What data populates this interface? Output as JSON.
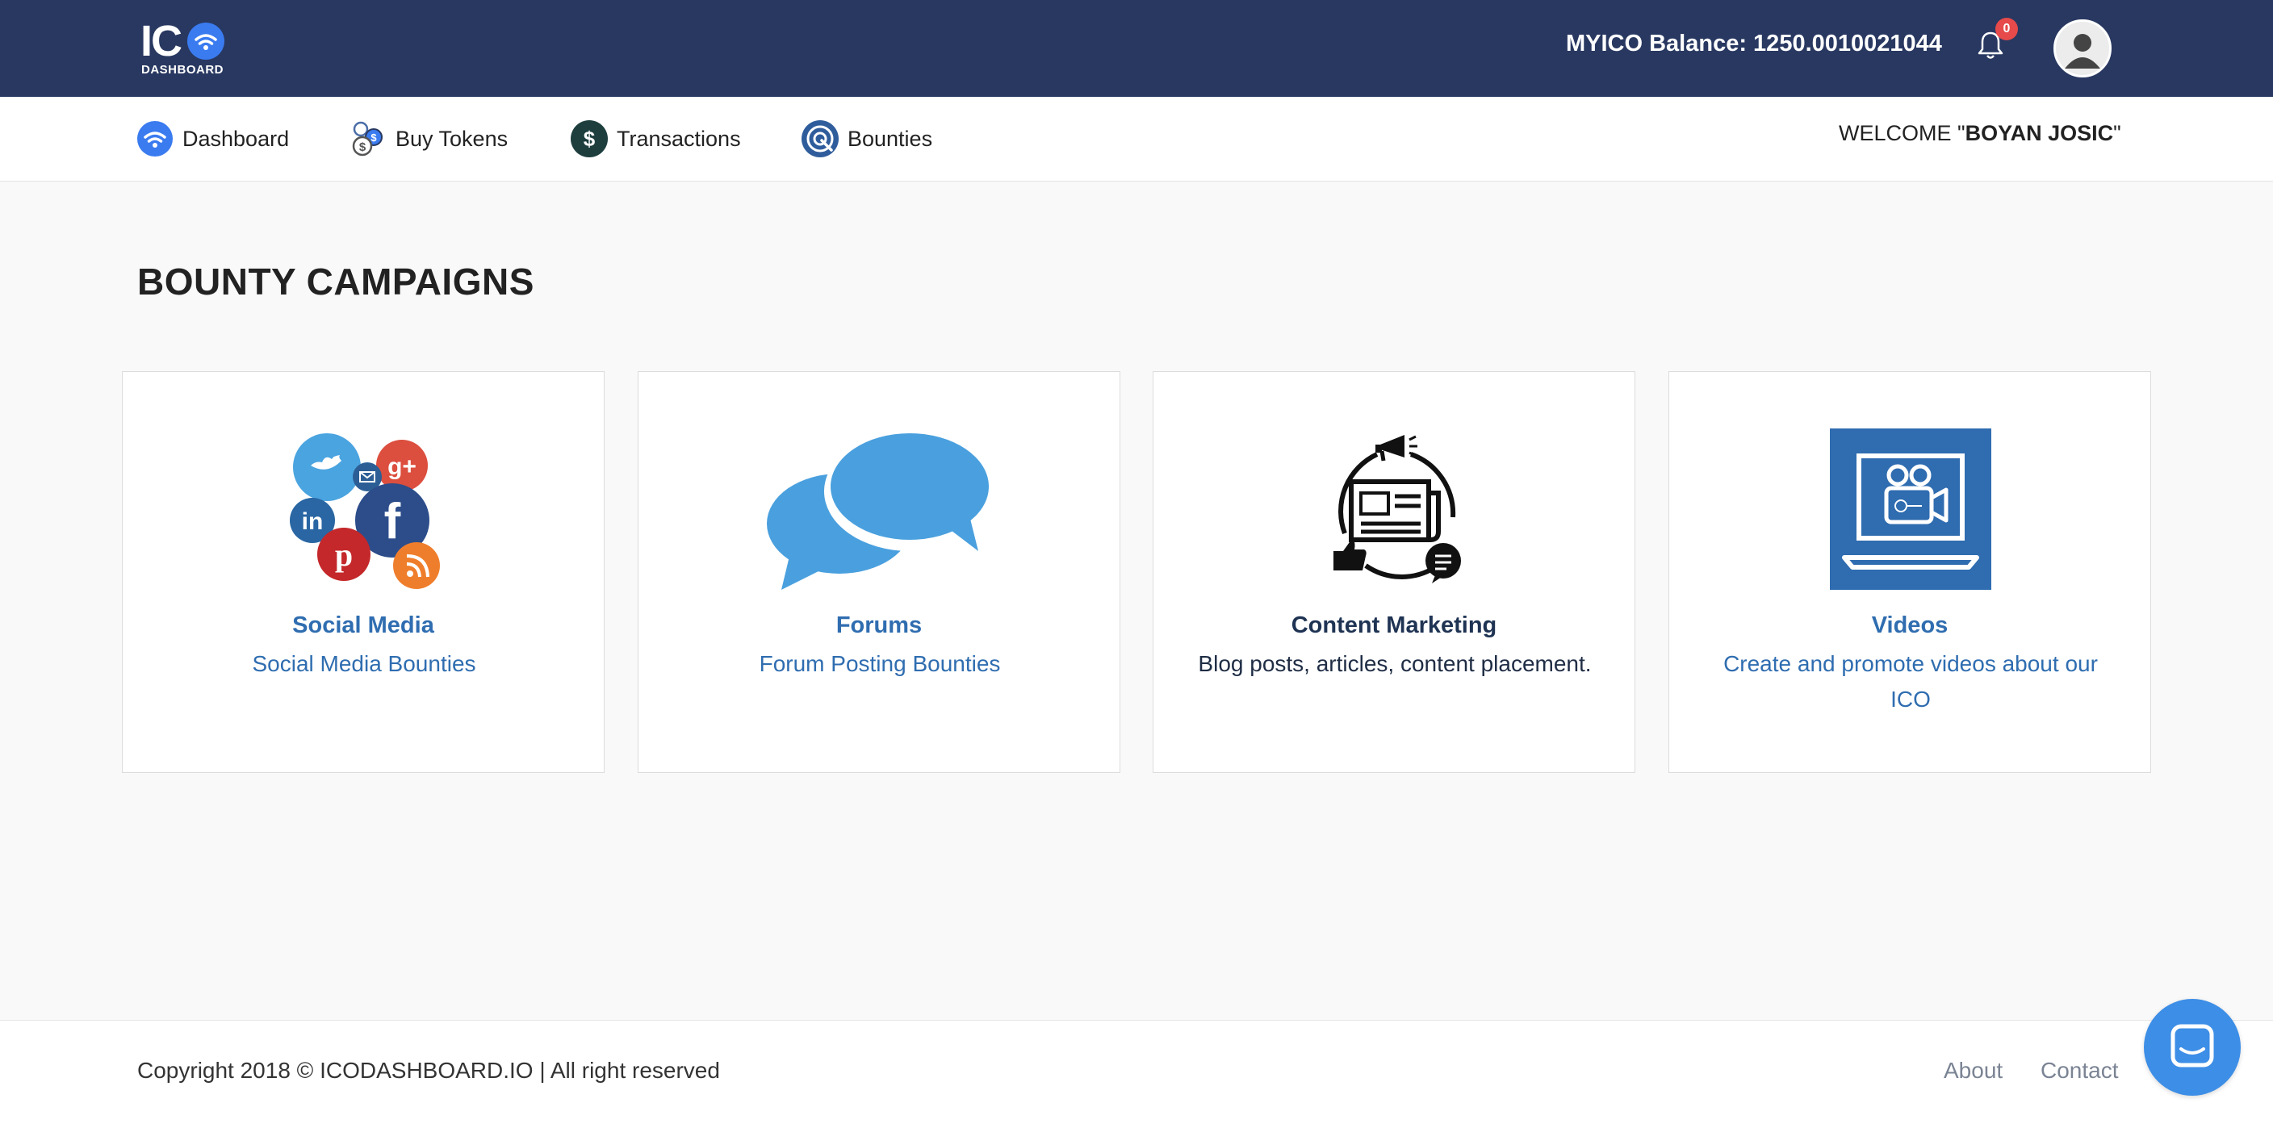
{
  "header": {
    "logo_text": "IC",
    "logo_sub": "DASHBOARD",
    "balance": "MYICO Balance: 1250.0010021044",
    "notification_count": "0"
  },
  "nav": {
    "items": [
      {
        "label": "Dashboard",
        "icon": "wifi-icon"
      },
      {
        "label": "Buy Tokens",
        "icon": "coins-icon"
      },
      {
        "label": "Transactions",
        "icon": "dollar-icon"
      },
      {
        "label": "Bounties",
        "icon": "target-icon"
      }
    ],
    "welcome_prefix": "WELCOME \"",
    "welcome_name": "BOYAN JOSIC",
    "welcome_suffix": "\""
  },
  "main": {
    "title": "BOUNTY CAMPAIGNS",
    "cards": [
      {
        "title": "Social Media",
        "desc": "Social Media Bounties",
        "icon": "social-media-icon"
      },
      {
        "title": "Forums",
        "desc": "Forum Posting Bounties",
        "icon": "speech-bubbles-icon"
      },
      {
        "title": "Content Marketing",
        "desc": "Blog posts, articles, content placement.",
        "icon": "newspaper-cycle-icon"
      },
      {
        "title": "Videos",
        "desc": "Create and promote videos about our ICO",
        "icon": "video-camera-laptop-icon"
      }
    ]
  },
  "footer": {
    "copyright": "Copyright 2018 © ICODASHBOARD.IO | All right reserved",
    "links": [
      "About",
      "Contact"
    ]
  },
  "colors": {
    "header_bg": "#283861",
    "accent": "#3a7bf0",
    "link_blue": "#2f6db0",
    "badge_red": "#e64a4a",
    "chat_blue": "#3d8ee6"
  }
}
